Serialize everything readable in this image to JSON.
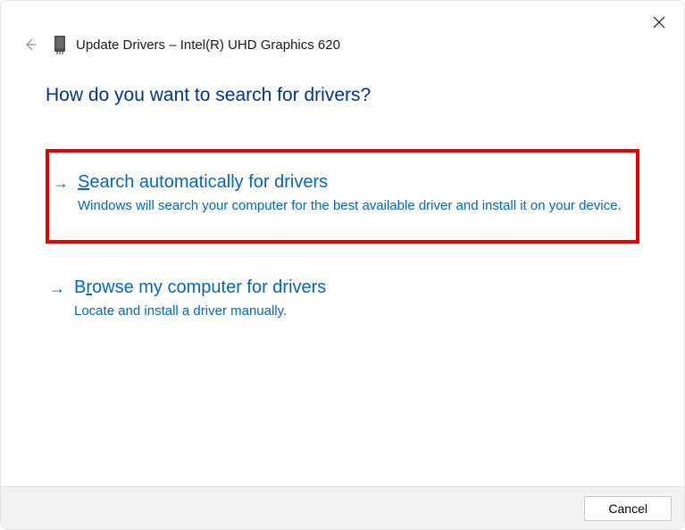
{
  "titlebar": {
    "title": "Update Drivers – Intel(R) UHD Graphics 620"
  },
  "heading": "How do you want to search for drivers?",
  "options": [
    {
      "title_prefix": "S",
      "title_rest": "earch automatically for drivers",
      "description": "Windows will search your computer for the best available driver and install it on your device.",
      "highlighted": true
    },
    {
      "title_prefix": "B",
      "title_mid": "r",
      "title_rest": "owse my computer for drivers",
      "description": "Locate and install a driver manually.",
      "highlighted": false
    }
  ],
  "footer": {
    "cancel_label": "Cancel"
  }
}
